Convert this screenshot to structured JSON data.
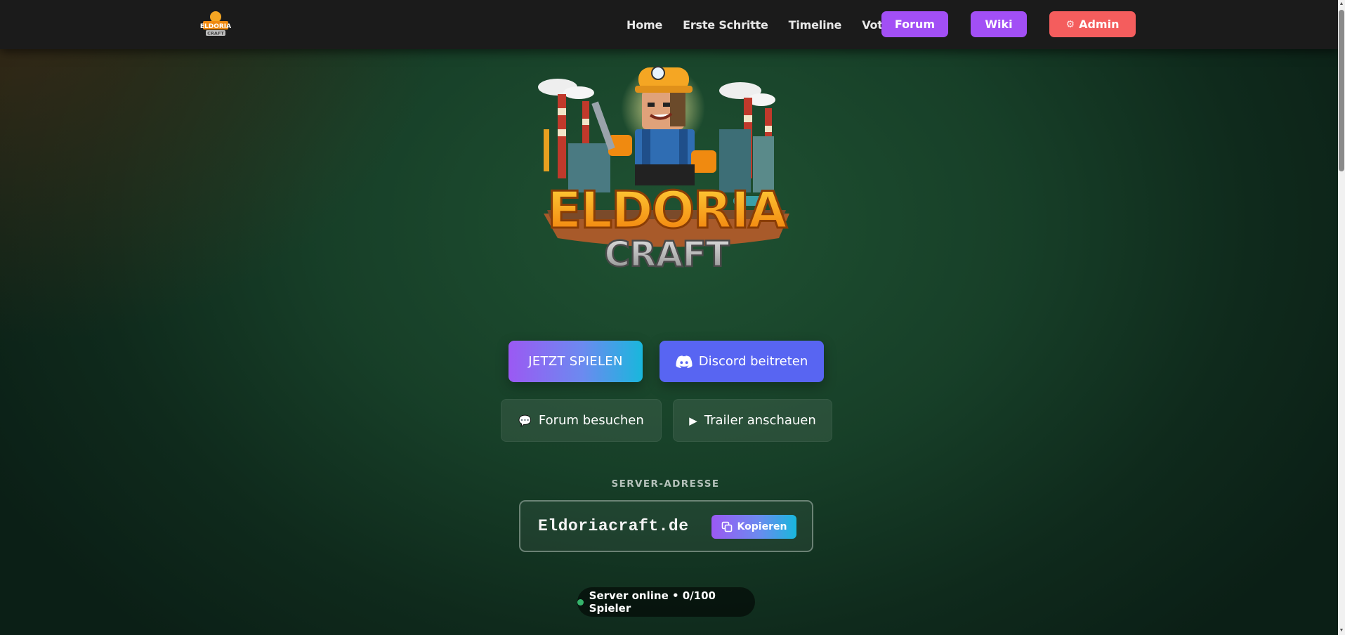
{
  "nav": {
    "logo_icon": "eldoria-craft-logo",
    "links": [
      "Home",
      "Erste Schritte",
      "Timeline",
      "Vote"
    ],
    "forum_label": "Forum",
    "wiki_label": "Wiki",
    "admin_label": "Admin",
    "admin_icon": "gear-icon"
  },
  "hero": {
    "logo_text_top": "ELDORIA",
    "logo_text_bottom": "CRAFT",
    "play_label": "JETZT SPIELEN",
    "discord_label": "Discord beitreten",
    "forum_visit_label": "Forum besuchen",
    "trailer_label": "Trailer anschauen"
  },
  "server": {
    "address_label": "SERVER-ADRESSE",
    "address": "Eldoriacraft.de",
    "copy_label": "Kopieren",
    "status_text": "Server online • 0/100 Spieler",
    "status_color": "#35b36b"
  },
  "colors": {
    "purple": "#a24ff5",
    "admin_red": "#f45d5d",
    "discord": "#5865f2",
    "navbar": "#1b1b1b"
  }
}
